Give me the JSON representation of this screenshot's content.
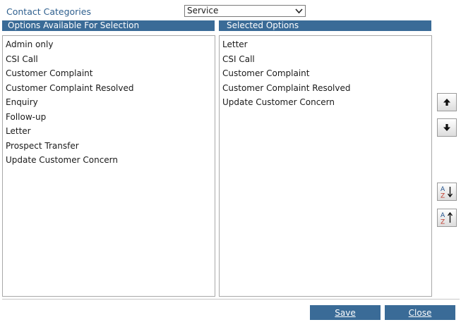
{
  "header": {
    "label": "Contact Categories",
    "select_value": "Service"
  },
  "available": {
    "title": "Options Available For Selection",
    "items": [
      "Admin only",
      "CSI Call",
      "Customer Complaint",
      "Customer Complaint Resolved",
      "Enquiry",
      "Follow-up",
      "Letter",
      "Prospect Transfer",
      "Update Customer Concern"
    ]
  },
  "selected": {
    "title": "Selected Options",
    "items": [
      "Letter",
      "CSI Call",
      "Customer Complaint",
      "Customer Complaint Resolved",
      "Update Customer Concern"
    ]
  },
  "side_buttons": {
    "move_up_icon": "arrow-up-icon",
    "move_down_icon": "arrow-down-icon",
    "sort_az_icon": "sort-a-z-icon",
    "sort_za_icon": "sort-z-a-icon"
  },
  "footer": {
    "save_label": "Save",
    "close_label": "Close"
  }
}
